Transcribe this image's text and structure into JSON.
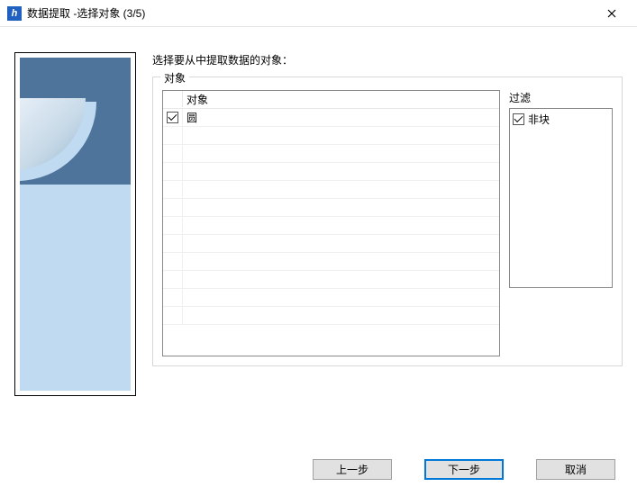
{
  "window": {
    "title": "数据提取 -选择对象 (3/5)",
    "app_icon_letter": "h"
  },
  "instruction": "选择要从中提取数据的对象：",
  "groupbox_title": "对象",
  "object_list": {
    "header": "对象",
    "rows": [
      {
        "label": "圆",
        "checked": true
      }
    ],
    "empty_rows": 11
  },
  "filter": {
    "label": "过滤",
    "rows": [
      {
        "label": "非块",
        "checked": true
      }
    ]
  },
  "buttons": {
    "back": "上一步",
    "next": "下一步",
    "cancel": "取消"
  }
}
